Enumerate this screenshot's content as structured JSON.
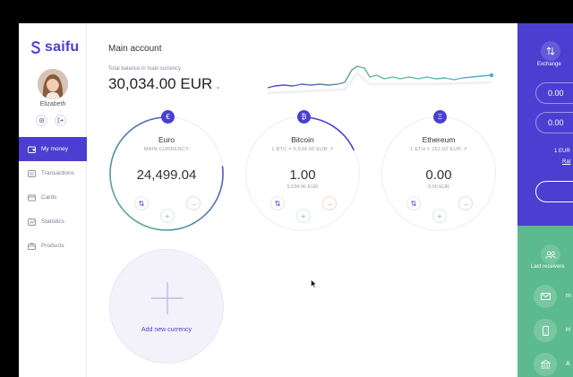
{
  "app": {
    "logo_text": "saifu",
    "brand_color": "#4a3fd1",
    "accent_green": "#5cba8f",
    "accent_red": "#e98a8a"
  },
  "user": {
    "name": "Elizabeth"
  },
  "nav": {
    "items": [
      {
        "label": "My money",
        "icon": "wallet-icon",
        "active": true
      },
      {
        "label": "Transactions",
        "icon": "transactions-icon",
        "active": false
      },
      {
        "label": "Cards",
        "icon": "card-icon",
        "active": false
      },
      {
        "label": "Statistics",
        "icon": "statistics-icon",
        "active": false
      },
      {
        "label": "Products",
        "icon": "products-icon",
        "active": false
      }
    ]
  },
  "main": {
    "title": "Main account",
    "balance_label": "Total balance in main currency",
    "balance_value": "30,034.00 EUR"
  },
  "currencies": [
    {
      "name": "Euro",
      "sub": "MAIN CURRENCY",
      "value": "24,499.04",
      "secondary": "",
      "badge": "€",
      "ring_fraction": 0.77
    },
    {
      "name": "Bitcoin",
      "sub": "1 BTC = 5,534.96 EUR ↗",
      "value": "1.00",
      "secondary": "5,534.96 EUR",
      "badge": "₿",
      "ring_fraction": 0.18
    },
    {
      "name": "Ethereum",
      "sub": "1 ETH = 262.62 EUR ↗",
      "value": "0.00",
      "secondary": "0.00 EUR",
      "badge": "Ξ",
      "ring_fraction": 0
    }
  ],
  "add_currency": {
    "label": "Add new currency"
  },
  "right_panel": {
    "exchange_label": "Exchange",
    "input1_value": "0.00",
    "input2_value": "0.00",
    "rate_text": "1 EUR",
    "rate_link": "Rat",
    "last_receivers_label": "Last receivers",
    "receivers": [
      {
        "initial": "m",
        "icon": "mail-icon"
      },
      {
        "initial": "H",
        "icon": "phone-icon"
      },
      {
        "initial": "A",
        "icon": "bank-icon"
      }
    ]
  }
}
